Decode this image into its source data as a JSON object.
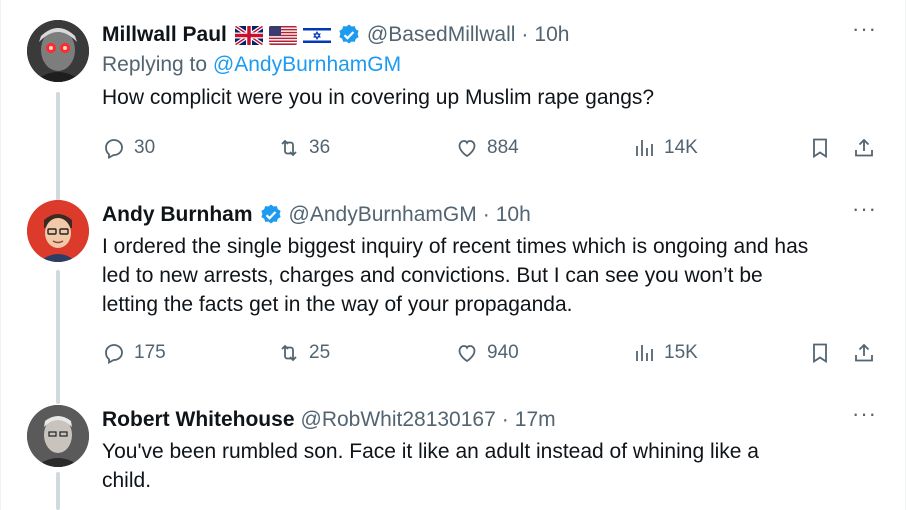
{
  "tweets": [
    {
      "author_name": "Millwall Paul",
      "flags": [
        "uk-flag-icon",
        "us-flag-icon",
        "israel-flag-icon"
      ],
      "handle": "@BasedMillwall",
      "separator": "·",
      "time": "10h",
      "replying_to_prefix": "Replying to",
      "replying_to_handle": "@AndyBurnhamGM",
      "text": "How complicit were you in covering up Muslim rape gangs?",
      "replies": "30",
      "reposts": "36",
      "likes": "884",
      "views": "14K",
      "more": "···"
    },
    {
      "author_name": "Andy Burnham",
      "handle": "@AndyBurnhamGM",
      "separator": "·",
      "time": "10h",
      "text_line1": "I ordered the single biggest inquiry of recent times which is ongoing and has",
      "text_line2": "led to new arrests, charges and convictions. But I can see you won’t be",
      "text_line3": "letting the facts get in the way of your propaganda.",
      "replies": "175",
      "reposts": "25",
      "likes": "940",
      "views": "15K",
      "more": "···"
    },
    {
      "author_name": "Robert Whitehouse",
      "handle": "@RobWhit28130167",
      "separator": "·",
      "time": "17m",
      "text_line1": "You've been rumbled son. Face it like an adult instead of whining like a",
      "text_line2": "child.",
      "more": "···"
    }
  ],
  "colors": {
    "accent": "#1d9bf0",
    "secondary_text": "#536471",
    "primary_text": "#0f1419",
    "thread_line": "#cfd9de"
  }
}
